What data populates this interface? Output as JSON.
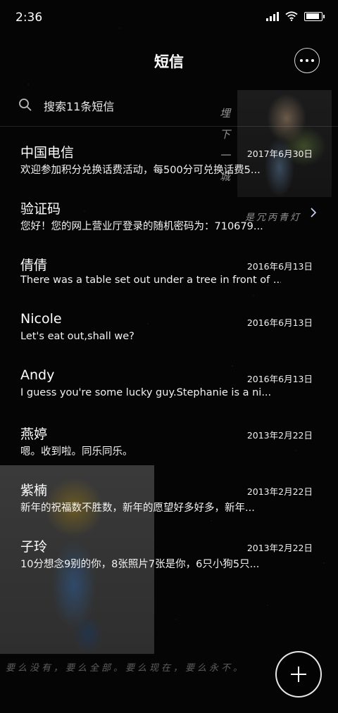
{
  "status": {
    "time": "2:36"
  },
  "header": {
    "title": "短信",
    "more_icon": "more-icon"
  },
  "search": {
    "label": "搜索11条短信",
    "icon": "search-icon"
  },
  "background": {
    "scribble_vertical": "埋下一城",
    "scribble_top": "是冗丙青灯",
    "scribble_bottom": "要么没有，要么全部。要么现在，要么永不。"
  },
  "messages": [
    {
      "name": "中国电信",
      "date": "2017年6月30日",
      "preview": "欢迎参加积分兑换话费活动，每500分可兑换话费5..."
    },
    {
      "name": "验证码",
      "date": "",
      "preview": "您好！您的网上营业厅登录的随机密码为：710679..."
    },
    {
      "name": "倩倩",
      "date": "2016年6月13日",
      "preview": "There was a table set out under a tree in front of ..."
    },
    {
      "name": "Nicole",
      "date": "2016年6月13日",
      "preview": "Let's eat out,shall we?"
    },
    {
      "name": "Andy",
      "date": "2016年6月13日",
      "preview": "I guess you're some lucky guy.Stephanie is a ni..."
    },
    {
      "name": "燕婷",
      "date": "2013年2月22日",
      "preview": "嗯。收到啦。同乐同乐。"
    },
    {
      "name": "紫楠",
      "date": "2013年2月22日",
      "preview": "新年的祝福数不胜数，新年的愿望好多好多，新年..."
    },
    {
      "name": "子玲",
      "date": "2013年2月22日",
      "preview": "10分想念9别的你，8张照片7张是你，6只小狗5只..."
    }
  ],
  "fab": {
    "icon": "plus-icon"
  }
}
